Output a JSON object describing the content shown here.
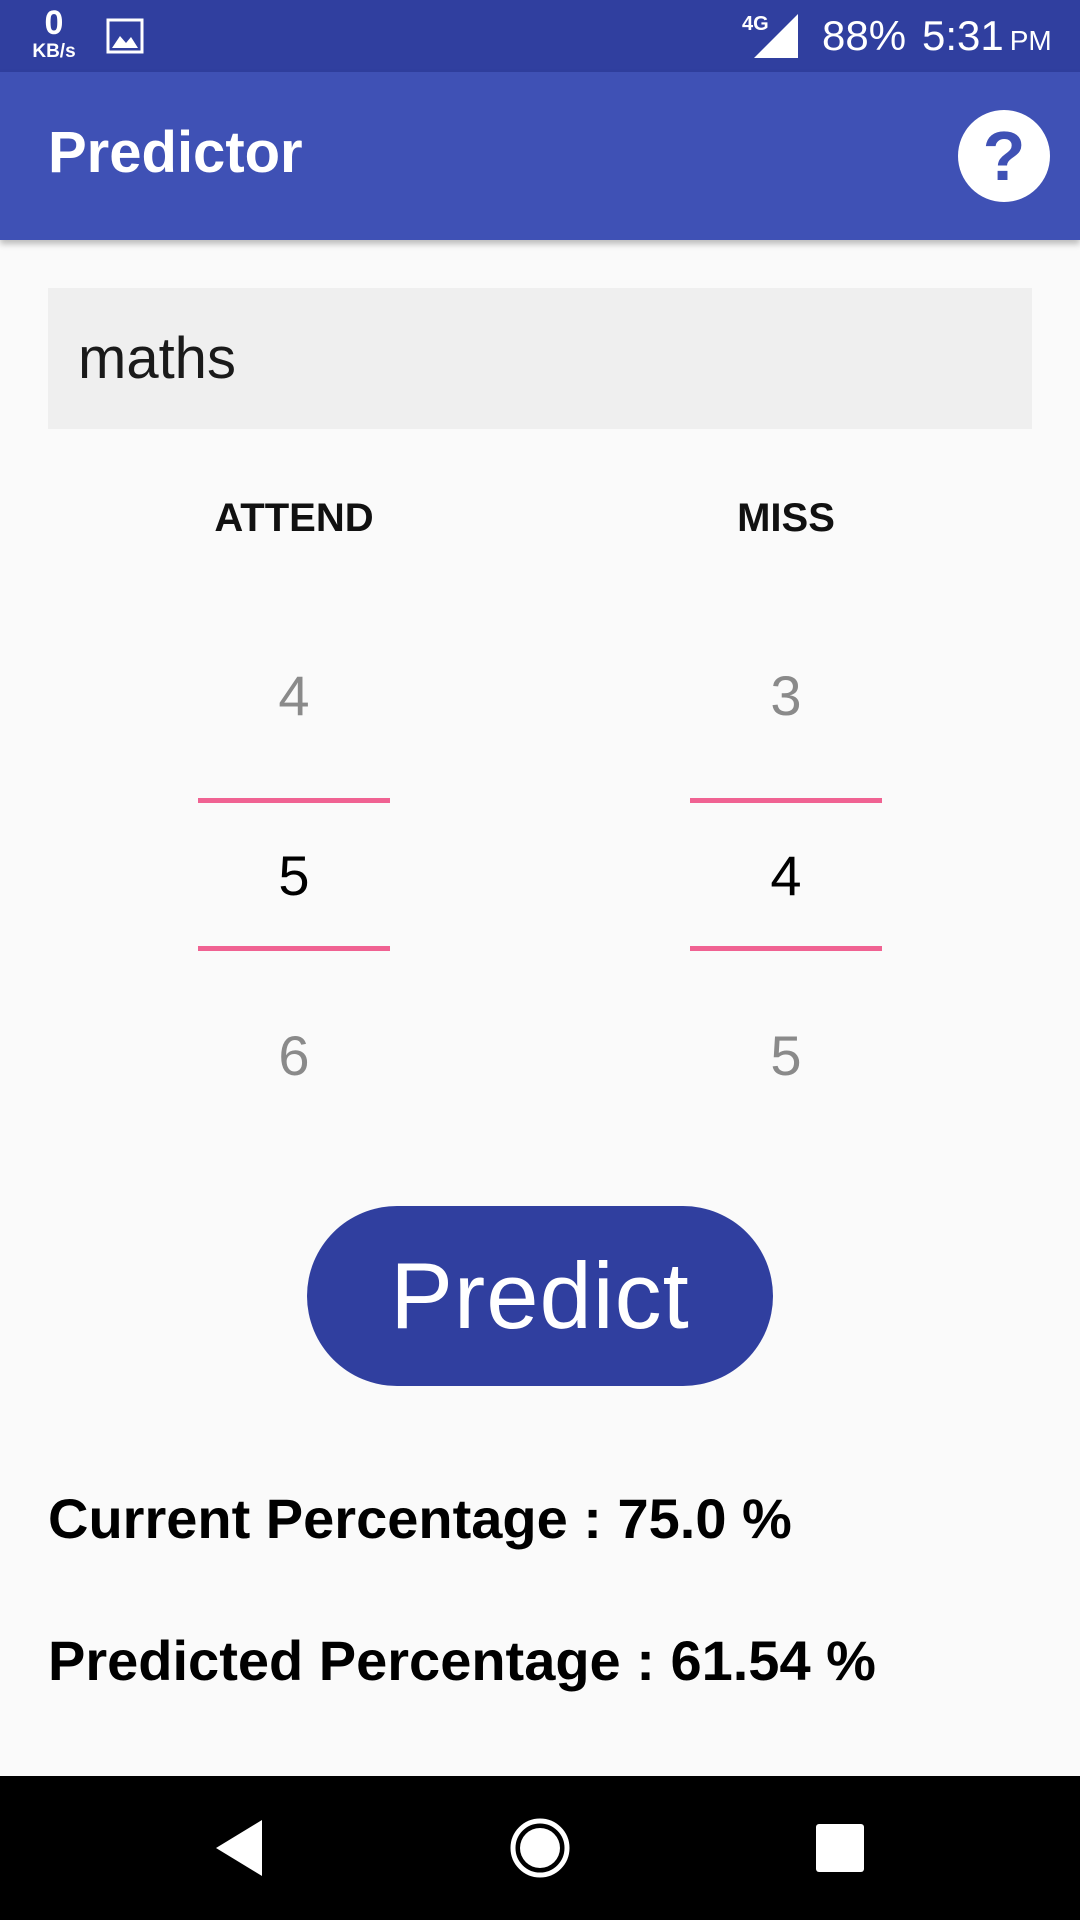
{
  "status_bar": {
    "net_speed_value": "0",
    "net_speed_unit": "KB/s",
    "network_type": "4G",
    "battery": "88%",
    "time": "5:31",
    "ampm": "PM",
    "icons": [
      "gallery-icon",
      "signal-icon"
    ]
  },
  "app_bar": {
    "title": "Predictor",
    "help_label": "?"
  },
  "subject": {
    "value": "maths"
  },
  "pickers": {
    "attend": {
      "label": "ATTEND",
      "prev": "4",
      "current": "5",
      "next": "6"
    },
    "miss": {
      "label": "MISS",
      "prev": "3",
      "current": "4",
      "next": "5"
    }
  },
  "predict_button": {
    "label": "Predict"
  },
  "results": {
    "current": "Current Percentage : 75.0 %",
    "predicted": "Predicted Percentage : 61.54 %"
  },
  "nav_bar": {
    "icons": [
      "back-icon",
      "home-icon",
      "recents-icon"
    ]
  },
  "colors": {
    "status_bar": "#303f9f",
    "app_bar": "#3f51b5",
    "accent": "#f06292",
    "button": "#303f9f",
    "background": "#fafafa"
  }
}
